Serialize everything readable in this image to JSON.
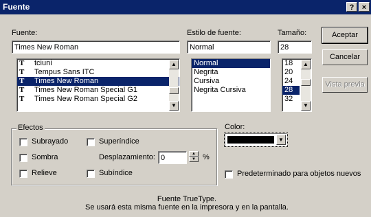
{
  "window": {
    "title": "Fuente",
    "help_btn": "?",
    "close_btn": "×"
  },
  "font": {
    "label": "Fuente:",
    "value": "Times New Roman",
    "list": [
      {
        "name": "tciuni",
        "icon": "truetype-icon"
      },
      {
        "name": "Tempus Sans ITC",
        "icon": "truetype-icon"
      },
      {
        "name": "Times New Roman",
        "icon": "truetype-icon",
        "selected": true
      },
      {
        "name": "Times New Roman Special G1",
        "icon": "truetype-icon"
      },
      {
        "name": "Times New Roman Special G2",
        "icon": "truetype-icon"
      }
    ]
  },
  "style": {
    "label": "Estilo de fuente:",
    "value": "Normal",
    "list": [
      "Normal",
      "Negrita",
      "Cursiva",
      "Negrita Cursiva"
    ],
    "selected": "Normal"
  },
  "size": {
    "label": "Tamaño:",
    "value": "28",
    "list": [
      "18",
      "20",
      "24",
      "28",
      "32"
    ],
    "selected": "28"
  },
  "buttons": {
    "accept": "Aceptar",
    "cancel": "Cancelar",
    "preview": "Vista previa"
  },
  "effects": {
    "label": "Efectos",
    "underline": "Subrayado",
    "shadow": "Sombra",
    "relief": "Relieve",
    "superscript": "Superíndice",
    "subscript": "Subíndice",
    "offset_label": "Desplazamiento:",
    "offset_value": "0",
    "offset_unit": "%"
  },
  "color": {
    "label": "Color:",
    "value_hex": "#000000"
  },
  "default_checkbox": "Predeterminado para objetos nuevos",
  "info": {
    "line1": "Fuente TrueType.",
    "line2": "Se usará esta misma fuente en la impresora y en la pantalla."
  }
}
